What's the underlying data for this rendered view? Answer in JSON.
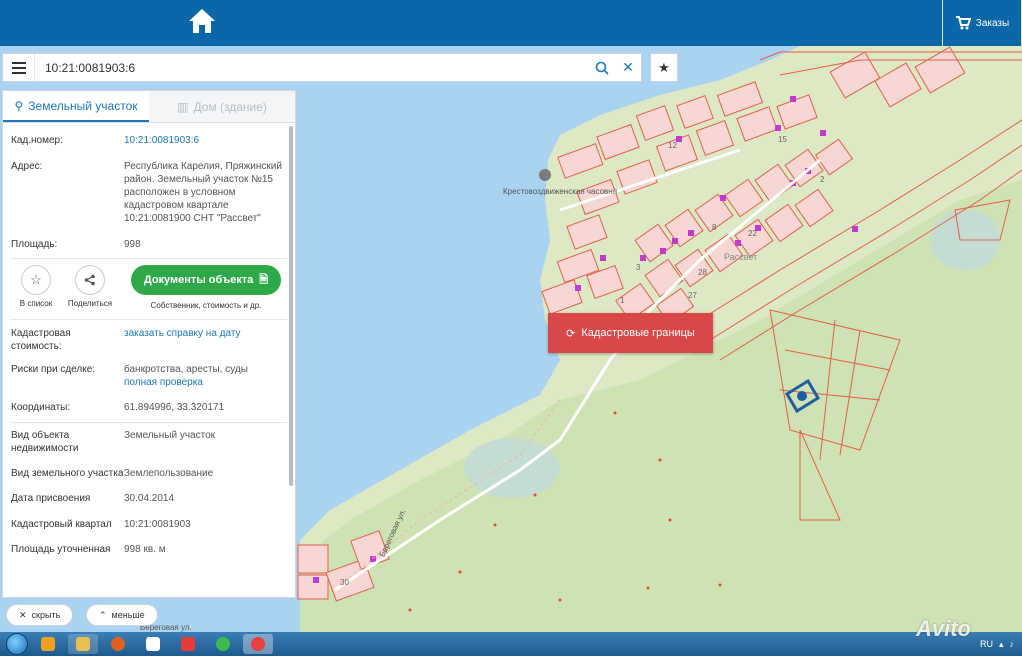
{
  "header": {
    "home_icon": "home-icon",
    "orders_label": "Заказы"
  },
  "search": {
    "value": "10:21:0081903:6"
  },
  "tabs": [
    {
      "label": "Земельный участок",
      "active": true
    },
    {
      "label": "Дом (здание)",
      "active": false
    }
  ],
  "info": {
    "cad_number": {
      "label": "Кад.номер:",
      "value": "10:21:0081903:6"
    },
    "address": {
      "label": "Адрес:",
      "value": "Республика Карелия, Пряжинский район. Земельный участок №15 расположен в условном кадастровом квартале 10:21:0081900 СНТ \"Рассвет\""
    },
    "area": {
      "label": "Площадь:",
      "value": "998"
    },
    "cad_cost": {
      "label": "Кадастровая стоимость:",
      "value": "заказать справку на дату"
    },
    "risks": {
      "label": "Риски при сделке:",
      "value": "банкротства, аресты, суды",
      "link": "полная проверка"
    },
    "coords": {
      "label": "Координаты:",
      "value": "61.894996, 33.320171"
    },
    "obj_type": {
      "label": "Вид объекта недвижимости",
      "value": "Земельный участок"
    },
    "land_type": {
      "label": "Вид земельного участка",
      "value": "Землепользование"
    },
    "date_assigned": {
      "label": "Дата присвоения",
      "value": "30.04.2014"
    },
    "cad_quarter": {
      "label": "Кадастровый квартал",
      "value": "10:21:0081903"
    },
    "area_refined": {
      "label": "Площадь уточненная",
      "value": "998 кв. м"
    }
  },
  "actions": {
    "to_list": "В список",
    "share": "Поделиться",
    "docs_button": "Документы объекта",
    "docs_caption": "Собственник, стоимость и др."
  },
  "bottom": {
    "hide": "скрыть",
    "less": "меньше"
  },
  "map": {
    "overlay_button": "Кадастровые границы",
    "labels": {
      "chapel": "Крестовоздвиженская часовня",
      "village": "Рассвет",
      "street1": "Береговая ул.",
      "street2": "Береговая ул.",
      "n1": "15",
      "n2": "3",
      "n3": "22",
      "n4": "28",
      "n5": "27",
      "n6": "1",
      "n7": "30",
      "n8": "2",
      "n9": "12",
      "n10": "8"
    },
    "colors": {
      "water": "#a9d3f1",
      "land": "#dde8c5",
      "forest": "#c7dfad",
      "parcel_fill": "#f6d7d3",
      "parcel_stroke": "#e0604a",
      "selected": "#1e5fa1"
    }
  },
  "taskbar": {
    "lang": "RU"
  },
  "watermark": "Avito"
}
